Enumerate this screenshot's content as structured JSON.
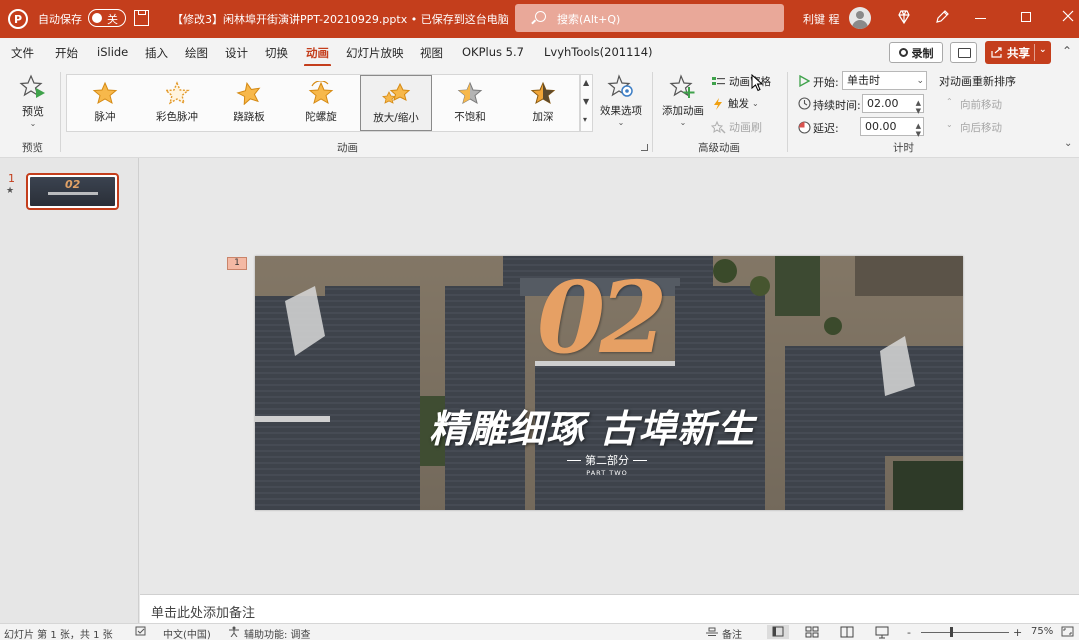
{
  "titlebar": {
    "logo": "P",
    "autosave_label": "自动保存",
    "autosave_state": "关",
    "document_title": "【修改3】闲林埠开街演讲PPT-20210929.pptx • 已保存到这台电脑",
    "search_placeholder": "搜索(Alt+Q)",
    "user_name": "利键 程",
    "bg_color": "#c43e1c"
  },
  "menu": {
    "tabs": [
      "文件",
      "开始",
      "iSlide",
      "插入",
      "绘图",
      "设计",
      "切换",
      "动画",
      "幻灯片放映",
      "视图",
      "OKPlus 5.7",
      "LvyhTools(201114)"
    ],
    "active_tab": "动画",
    "record_label": "录制",
    "share_label": "共享"
  },
  "ribbon": {
    "preview": {
      "label": "预览",
      "group": "预览"
    },
    "animations": {
      "group": "动画",
      "items": [
        {
          "label": "脉冲",
          "icon": "pulse-star-icon",
          "color": "#f2a33a"
        },
        {
          "label": "彩色脉冲",
          "icon": "color-pulse-star-icon",
          "color": "#f2a33a"
        },
        {
          "label": "跷跷板",
          "icon": "teeter-star-icon",
          "color": "#f2a33a"
        },
        {
          "label": "陀螺旋",
          "icon": "spin-star-icon",
          "color": "#f2a33a"
        },
        {
          "label": "放大/缩小",
          "icon": "grow-shrink-star-icon",
          "color": "#f2a33a",
          "selected": true
        },
        {
          "label": "不饱和",
          "icon": "desaturate-star-icon",
          "color": "#9c9c9c"
        },
        {
          "label": "加深",
          "icon": "darken-star-icon",
          "color": "#b7731f"
        }
      ],
      "effect_options": "效果选项"
    },
    "advanced": {
      "group": "高级动画",
      "add_animation": "添加动画",
      "animation_pane": "动画窗格",
      "trigger": "触发",
      "animation_painter": "动画刷"
    },
    "timing": {
      "group": "计时",
      "start_label": "开始:",
      "start_value": "单击时",
      "duration_label": "持续时间:",
      "duration_value": "02.00",
      "delay_label": "延迟:",
      "delay_value": "00.00",
      "reorder_label": "对动画重新排序",
      "move_earlier": "向前移动",
      "move_later": "向后移动"
    }
  },
  "slides_pane": {
    "slide_number": "1",
    "animation_marker": "★"
  },
  "slide": {
    "animation_tag": "1",
    "big_number": "02",
    "headline": "精雕细琢 古埠新生",
    "section": "第二部分",
    "section_en": "PART TWO"
  },
  "notes": {
    "placeholder": "单击此处添加备注"
  },
  "statusbar": {
    "slide_info": "幻灯片 第 1 张，共 1 张",
    "language": "中文(中国)",
    "accessibility": "辅助功能: 调查",
    "notes_button": "备注",
    "zoom_minus": "-",
    "zoom_plus": "+",
    "zoom_level": "75%"
  }
}
